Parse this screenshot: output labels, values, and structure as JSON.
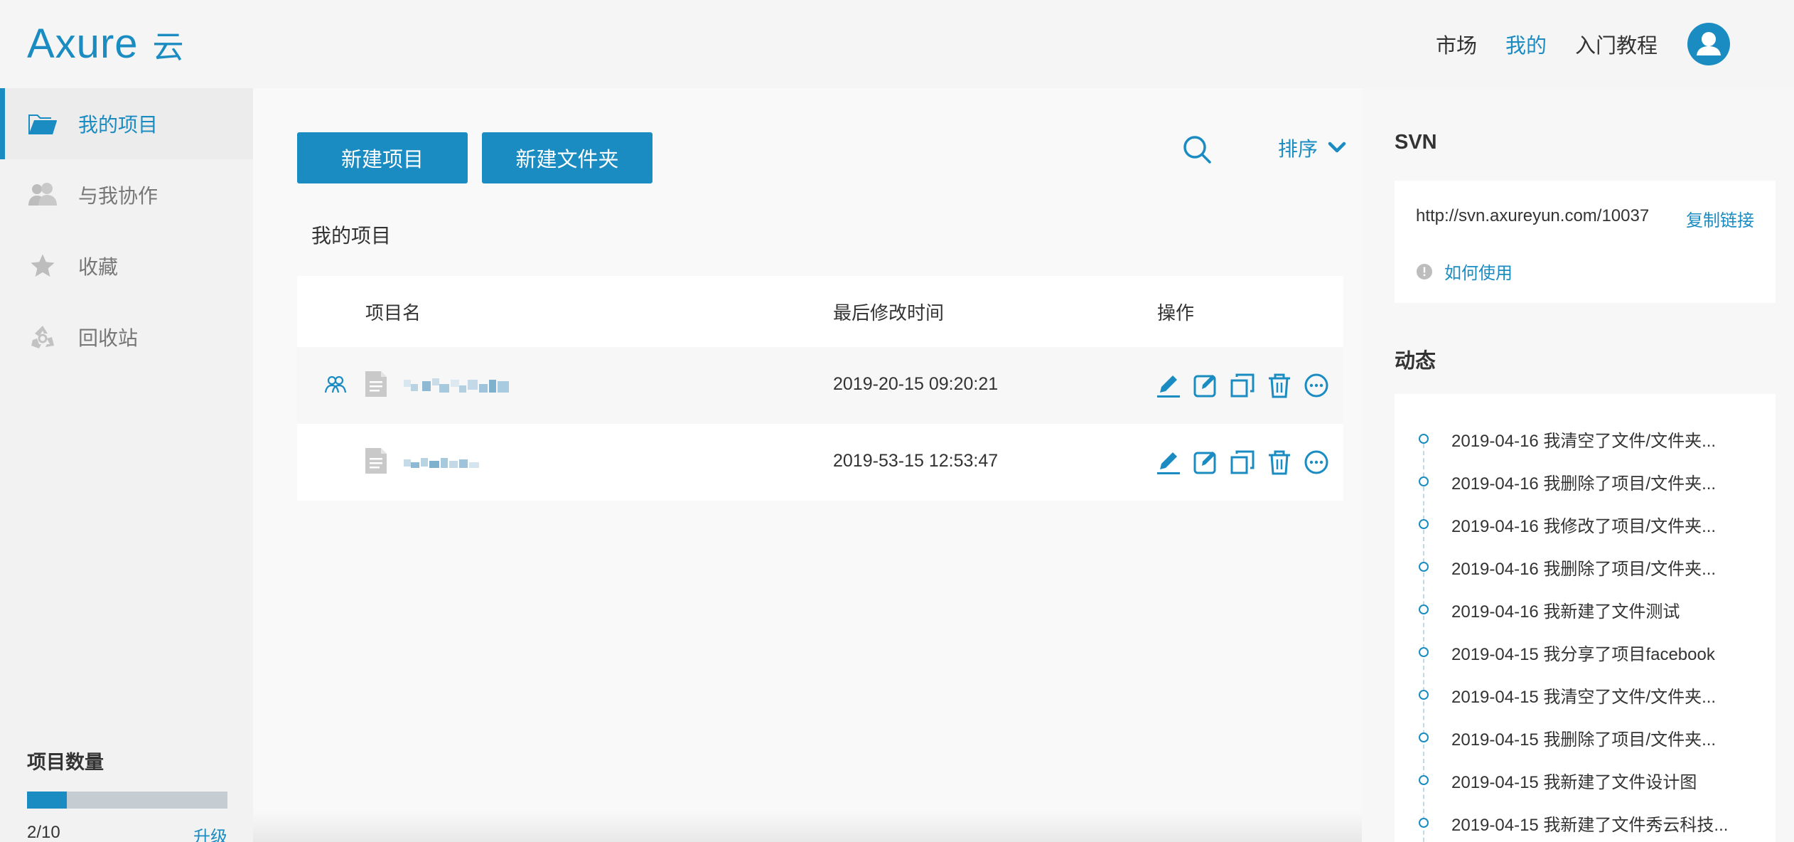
{
  "header": {
    "logo_text": "Axure",
    "logo_sub": "云",
    "nav": [
      {
        "label": "市场",
        "active": false
      },
      {
        "label": "我的",
        "active": true
      },
      {
        "label": "入门教程",
        "active": false
      }
    ]
  },
  "sidebar": {
    "items": [
      {
        "label": "我的项目",
        "icon": "folder-open-icon",
        "active": true
      },
      {
        "label": "与我协作",
        "icon": "users-icon",
        "active": false
      },
      {
        "label": "收藏",
        "icon": "star-icon",
        "active": false
      },
      {
        "label": "回收站",
        "icon": "recycle-icon",
        "active": false
      }
    ],
    "quota": {
      "title": "项目数量",
      "count_text": "2/10",
      "used": 2,
      "total": 10,
      "upgrade_label": "升级"
    }
  },
  "main": {
    "new_project_label": "新建项目",
    "new_folder_label": "新建文件夹",
    "sort_label": "排序",
    "section_title": "我的项目",
    "table": {
      "columns": [
        "项目名",
        "最后修改时间",
        "操作"
      ],
      "rows": [
        {
          "name": "",
          "shared": true,
          "time": "2019-20-15 09:20:21"
        },
        {
          "name": "",
          "shared": false,
          "time": "2019-53-15 12:53:47"
        }
      ],
      "ops": [
        "edit-icon",
        "rename-icon",
        "copy-icon",
        "delete-icon",
        "more-icon"
      ]
    }
  },
  "right": {
    "svn_title": "SVN",
    "svn_url": "http://svn.axureyun.com/10037",
    "copy_label": "复制链接",
    "help_label": "如何使用",
    "activity_title": "动态",
    "activities": [
      "2019-04-16 我清空了文件/文件夹...",
      "2019-04-16 我删除了项目/文件夹...",
      "2019-04-16 我修改了项目/文件夹...",
      "2019-04-16 我删除了项目/文件夹...",
      "2019-04-16 我新建了文件测试",
      "2019-04-15 我分享了项目facebook",
      "2019-04-15 我清空了文件/文件夹...",
      "2019-04-15 我删除了项目/文件夹...",
      "2019-04-15 我新建了文件设计图",
      "2019-04-15 我新建了文件秀云科技..."
    ]
  },
  "colors": {
    "accent": "#1a8cc2",
    "sidebar_bg": "#f2f2f2",
    "muted_text": "#777777"
  }
}
